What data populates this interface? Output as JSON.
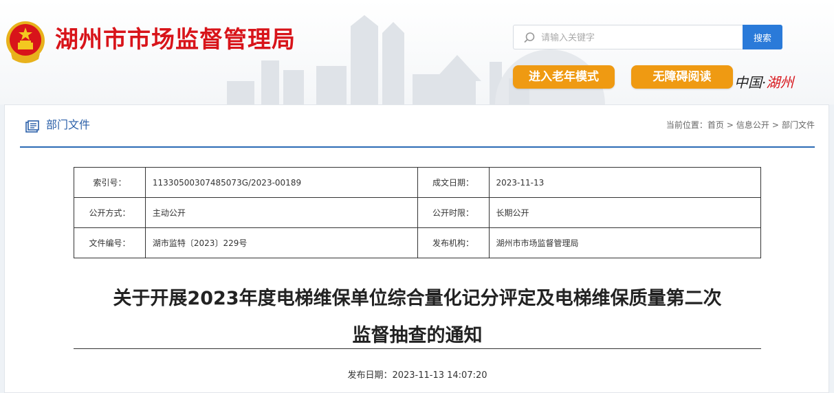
{
  "header": {
    "site_title": "湖州市市场监督管理局",
    "search_placeholder": "请输入关键字",
    "search_button": "搜索",
    "elder_mode": "进入老年模式",
    "accessible_reading": "无障碍阅读",
    "brand_prefix": "中国·",
    "brand_city": "湖州"
  },
  "section": {
    "title": "部门文件",
    "breadcrumb": {
      "prefix": "当前位置：",
      "items": [
        "首页",
        "信息公开",
        "部门文件"
      ],
      "separator": ">"
    }
  },
  "meta_table": {
    "rows": [
      [
        {
          "label": "索引号：",
          "value": "11330500307485073G/2023-00189"
        },
        {
          "label": "成文日期：",
          "value": "2023-11-13"
        }
      ],
      [
        {
          "label": "公开方式：",
          "value": "主动公开"
        },
        {
          "label": "公开时限：",
          "value": "长期公开"
        }
      ],
      [
        {
          "label": "文件编号：",
          "value": "湖市监特〔2023〕229号"
        },
        {
          "label": "发布机构：",
          "value": "湖州市市场监督管理局"
        }
      ]
    ]
  },
  "document": {
    "title_line1": "关于开展2023年度电梯维保单位综合量化记分评定及电梯维保质量第二次",
    "title_line2": "监督抽查的通知",
    "publish_date": "发布日期：2023-11-13 14:07:20"
  },
  "colors": {
    "brand_red": "#d8141a",
    "search_blue": "#2a7ad9",
    "pill_orange": "#ef9a12",
    "section_blue": "#2a6ab5"
  }
}
